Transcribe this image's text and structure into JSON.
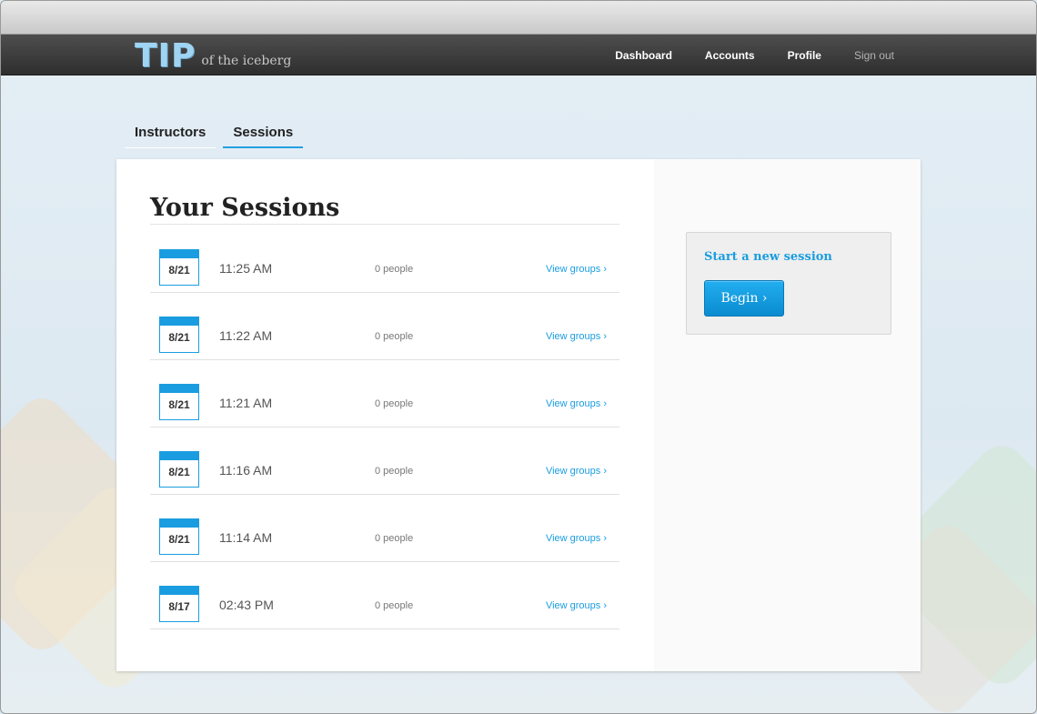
{
  "logo": {
    "mark": "TIP",
    "tagline": "of the iceberg"
  },
  "nav": {
    "dashboard": "Dashboard",
    "accounts": "Accounts",
    "profile": "Profile",
    "signout": "Sign out"
  },
  "tabs": [
    {
      "label": "Instructors",
      "active": false
    },
    {
      "label": "Sessions",
      "active": true
    }
  ],
  "sessions_title": "Your Sessions",
  "sessions": [
    {
      "date": "8/21",
      "time": "11:25 AM",
      "people": "0 people",
      "link": "View groups ›"
    },
    {
      "date": "8/21",
      "time": "11:22 AM",
      "people": "0 people",
      "link": "View groups ›"
    },
    {
      "date": "8/21",
      "time": "11:21 AM",
      "people": "0 people",
      "link": "View groups ›"
    },
    {
      "date": "8/21",
      "time": "11:16 AM",
      "people": "0 people",
      "link": "View groups ›"
    },
    {
      "date": "8/21",
      "time": "11:14 AM",
      "people": "0 people",
      "link": "View groups ›"
    },
    {
      "date": "8/17",
      "time": "02:43 PM",
      "people": "0 people",
      "link": "View groups ›"
    }
  ],
  "new_session": {
    "title": "Start a new session",
    "button": "Begin ›"
  },
  "colors": {
    "accent": "#1a9de0",
    "nav_bg": "#3a3a3a",
    "page_bg": "#dde9f1"
  }
}
